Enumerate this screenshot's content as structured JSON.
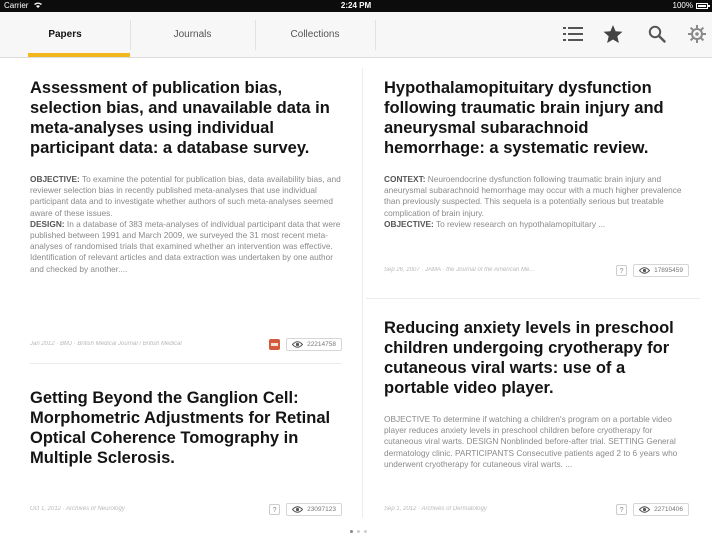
{
  "status_bar": {
    "carrier": "Carrier",
    "time": "2:24 PM",
    "battery": "100%"
  },
  "tabs": [
    {
      "label": "Papers",
      "active": true
    },
    {
      "label": "Journals",
      "active": false
    },
    {
      "label": "Collections",
      "active": false
    }
  ],
  "toolbar_icons": [
    "list-icon",
    "star-icon",
    "search-icon",
    "gear-icon"
  ],
  "colors": {
    "accent": "#f2b71d",
    "title": "#141414",
    "abstract": "#8a8a8a"
  },
  "cards": [
    {
      "title": "Assessment of publication bias, selection bias, and unavailable data in meta-analyses using individual participant data: a database survey.",
      "abstract": [
        {
          "label": "OBJECTIVE:",
          "text": " To examine the potential for publication bias, data availability bias, and reviewer selection bias in recently published meta-analyses that use individual participant data and to investigate whether authors of such meta-analyses seemed aware of these issues."
        },
        {
          "label": "DESIGN:",
          "text": " In a database of 383 meta-analyses of individual participant data that were published between 1991 and March 2009, we surveyed the 31 most recent meta-analyses of randomised trials that examined whether an intervention was effective. Identification of relevant articles and data extraction was undertaken by one author and checked by another...."
        }
      ],
      "citation": "Jan 2012 · BMJ · British Medical Journal / British Medical",
      "badge": "pdf",
      "views": "22214758"
    },
    {
      "title": "Getting Beyond the Ganglion Cell: Morphometric Adjustments for Retinal Optical Coherence Tomography in Multiple Sclerosis.",
      "abstract": [],
      "citation": "Oct 1, 2012 · Archives of Neurology",
      "badge": "?",
      "views": "23097123"
    },
    {
      "title": "Hypothalamopituitary dysfunction following traumatic brain injury and aneurysmal subarachnoid hemorrhage: a systematic review.",
      "abstract": [
        {
          "label": "CONTEXT:",
          "text": " Neuroendocrine dysfunction following traumatic brain injury and aneurysmal subarachnoid hemorrhage may occur with a much higher prevalence than previously suspected. This sequela is a potentially serious but treatable complication of brain injury."
        },
        {
          "label": "OBJECTIVE:",
          "text": " To review research on hypothalamopituitary ..."
        }
      ],
      "citation": "Sep 26, 2007 · JAMA · the Journal of the American Me...",
      "badge": "?",
      "views": "17895459"
    },
    {
      "title": "Reducing anxiety levels in preschool children undergoing cryotherapy for cutaneous viral warts: use of a portable video player.",
      "abstract": [
        {
          "label": "",
          "text": "OBJECTIVE To determine if watching a children's program on a portable video player reduces anxiety levels in preschool children before cryotherapy for cutaneous viral warts. DESIGN Nonblinded before-after trial. SETTING General dermatology clinic. PARTICIPANTS Consecutive patients aged 2 to 6 years who underwent cryotherapy for cutaneous viral warts. ..."
        }
      ],
      "citation": "Sep 1, 2012 · Archives of Dermatology",
      "badge": "?",
      "views": "22710406"
    }
  ]
}
